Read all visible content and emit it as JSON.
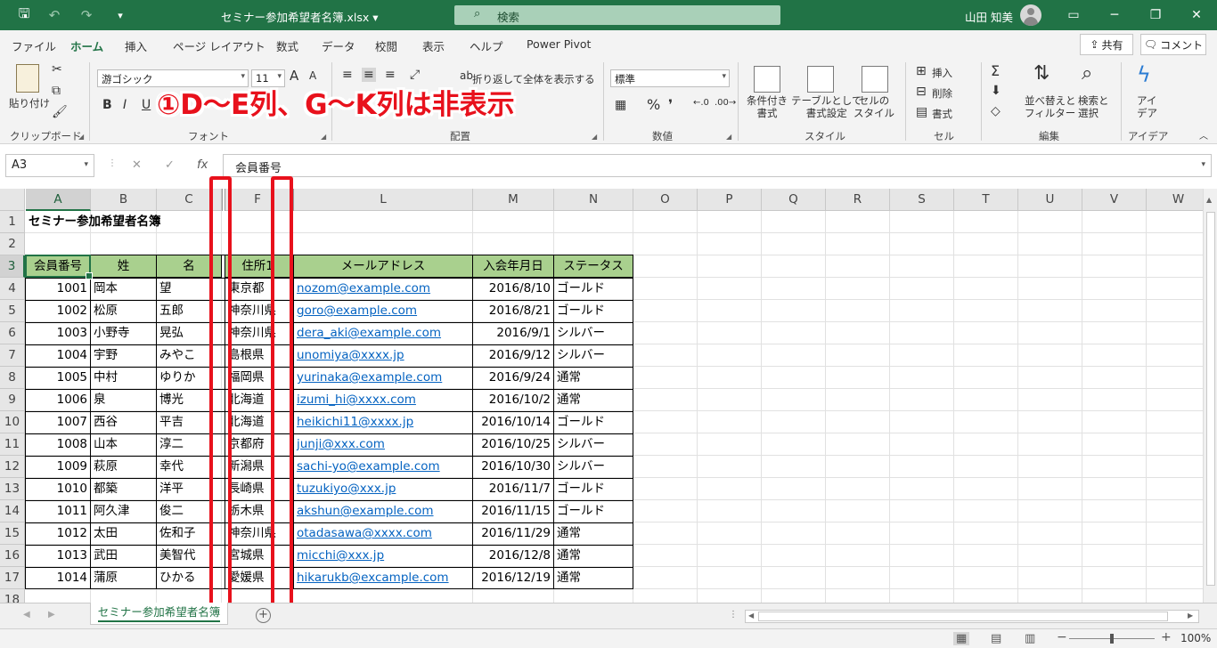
{
  "titlebar": {
    "doc_title": "セミナー参加希望者名簿.xlsx  ▾",
    "search_label": "検索",
    "user_name": "山田 知美"
  },
  "tabs": [
    "ファイル",
    "ホーム",
    "挿入",
    "ページ レイアウト",
    "数式",
    "データ",
    "校閲",
    "表示",
    "ヘルプ",
    "Power Pivot"
  ],
  "actions": {
    "share": "共有",
    "comment": "コメント"
  },
  "ribbon": {
    "clipboard": {
      "paste": "貼り付け",
      "label": "クリップボード"
    },
    "font": {
      "name": "游ゴシック",
      "size": "11",
      "label": "フォント",
      "bold": "B",
      "italic": "I",
      "underline": "U",
      "grow": "A",
      "shrink": "A"
    },
    "alignment": {
      "wrap": "折り返して全体を表示する",
      "label": "配置"
    },
    "number": {
      "format": "標準",
      "label": "数値"
    },
    "styles": {
      "conditional": "条件付き\n書式",
      "table": "テーブルとして\n書式設定",
      "cell": "セルの\nスタイル",
      "label": "スタイル"
    },
    "cells": {
      "insert": "挿入",
      "delete": "削除",
      "format": "書式",
      "label": "セル"
    },
    "editing": {
      "sort": "並べ替えと\nフィルター",
      "find": "検索と\n選択",
      "label": "編集"
    },
    "ideas": {
      "button": "アイ\nデア",
      "label": "アイデア"
    }
  },
  "callout": "①D～E列、G～K列は非表示",
  "formula_bar": {
    "name_box": "A3",
    "content": "会員番号"
  },
  "columns": [
    "A",
    "B",
    "C",
    "F",
    "L",
    "M",
    "N",
    "O",
    "P",
    "Q",
    "R",
    "S",
    "T",
    "U",
    "V",
    "W"
  ],
  "rows": [
    "1",
    "2",
    "3",
    "4",
    "5",
    "6",
    "7",
    "8",
    "9",
    "10",
    "11",
    "12",
    "13",
    "14",
    "15",
    "16",
    "17",
    "18"
  ],
  "sheet": {
    "title": "セミナー参加希望者名簿",
    "headers": [
      "会員番号",
      "姓",
      "名",
      "住所1",
      "メールアドレス",
      "入会年月日",
      "ステータス"
    ],
    "records": [
      [
        "1001",
        "岡本",
        "望",
        "東京都",
        "nozom@example.com",
        "2016/8/10",
        "ゴールド"
      ],
      [
        "1002",
        "松原",
        "五郎",
        "神奈川県",
        "goro@example.com",
        "2016/8/21",
        "ゴールド"
      ],
      [
        "1003",
        "小野寺",
        "晃弘",
        "神奈川県",
        "dera_aki@example.com",
        "2016/9/1",
        "シルバー"
      ],
      [
        "1004",
        "宇野",
        "みやこ",
        "島根県",
        "unomiya@xxxx.jp",
        "2016/9/12",
        "シルバー"
      ],
      [
        "1005",
        "中村",
        "ゆりか",
        "福岡県",
        "yurinaka@example.com",
        "2016/9/24",
        "通常"
      ],
      [
        "1006",
        "泉",
        "博光",
        "北海道",
        "izumi_hi@xxxx.com",
        "2016/10/2",
        "通常"
      ],
      [
        "1007",
        "西谷",
        "平吉",
        "北海道",
        "heikichi11@xxxx.jp",
        "2016/10/14",
        "ゴールド"
      ],
      [
        "1008",
        "山本",
        "淳二",
        "京都府",
        "junji@xxx.com",
        "2016/10/25",
        "シルバー"
      ],
      [
        "1009",
        "萩原",
        "幸代",
        "新潟県",
        "sachi-yo@example.com",
        "2016/10/30",
        "シルバー"
      ],
      [
        "1010",
        "都築",
        "洋平",
        "長崎県",
        "tuzukiyo@xxx.jp",
        "2016/11/7",
        "ゴールド"
      ],
      [
        "1011",
        "阿久津",
        "俊二",
        "栃木県",
        "akshun@example.com",
        "2016/11/15",
        "ゴールド"
      ],
      [
        "1012",
        "太田",
        "佐和子",
        "神奈川県",
        "otadasawa@xxxx.com",
        "2016/11/29",
        "通常"
      ],
      [
        "1013",
        "武田",
        "美智代",
        "宮城県",
        "micchi@xxx.jp",
        "2016/12/8",
        "通常"
      ],
      [
        "1014",
        "蒲原",
        "ひかる",
        "愛媛県",
        "hikarukb@excample.com",
        "2016/12/19",
        "通常"
      ]
    ]
  },
  "sheet_tab": "セミナー参加希望者名簿",
  "status": {
    "zoom": "100%"
  },
  "colors": {
    "excel_green": "#217346",
    "header_fill": "#a9d08e",
    "link": "#0563c1",
    "highlight_red": "#e8111c"
  }
}
